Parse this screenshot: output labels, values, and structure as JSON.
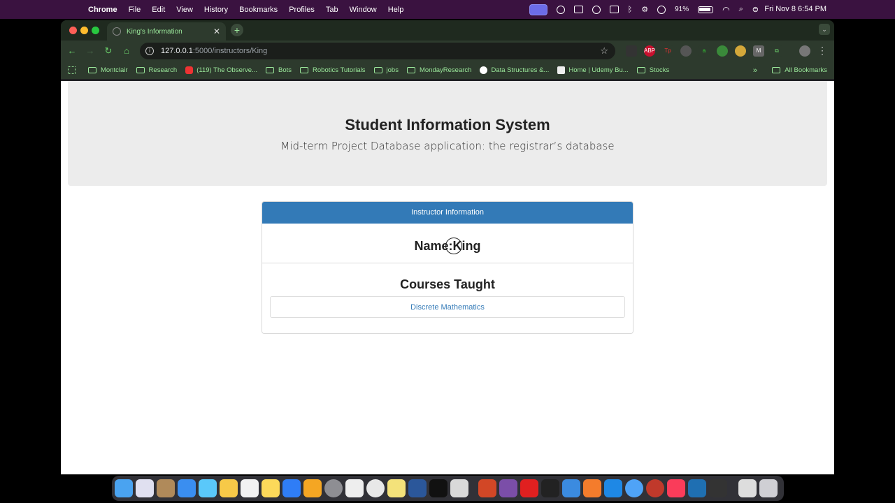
{
  "menubar": {
    "app_name": "Chrome",
    "items": [
      "File",
      "Edit",
      "View",
      "History",
      "Bookmarks",
      "Profiles",
      "Tab",
      "Window",
      "Help"
    ],
    "battery": "91%",
    "datetime": "Fri Nov 8  6:54 PM"
  },
  "browser": {
    "tab_title": "King's Information",
    "url_host": "127.0.0.1",
    "url_path": ":5000/instructors/King",
    "bookmarks": [
      {
        "label": "Montclair",
        "type": "folder"
      },
      {
        "label": "Research",
        "type": "folder"
      },
      {
        "label": "(119) The Observe...",
        "type": "site"
      },
      {
        "label": "Bots",
        "type": "folder"
      },
      {
        "label": "Robotics Tutorials",
        "type": "folder"
      },
      {
        "label": "jobs",
        "type": "folder"
      },
      {
        "label": "MondayResearch",
        "type": "folder"
      },
      {
        "label": "Data Structures &...",
        "type": "site"
      },
      {
        "label": "Home | Udemy Bu...",
        "type": "site"
      },
      {
        "label": "Stocks",
        "type": "folder"
      }
    ],
    "all_bookmarks": "All Bookmarks"
  },
  "page": {
    "title": "Student Information System",
    "subtitle": "Mid-term Project Database application: the registrar’s database",
    "panel_heading": "Instructor Information",
    "name_line": "Name:King",
    "courses_title": "Courses Taught",
    "courses": [
      "Discrete Mathematics"
    ]
  },
  "colors": {
    "panel_heading": "#337ab7",
    "jumbotron": "#ececec",
    "chrome_theme": "#2d3a2d",
    "bookmark_text": "#9be89b"
  }
}
